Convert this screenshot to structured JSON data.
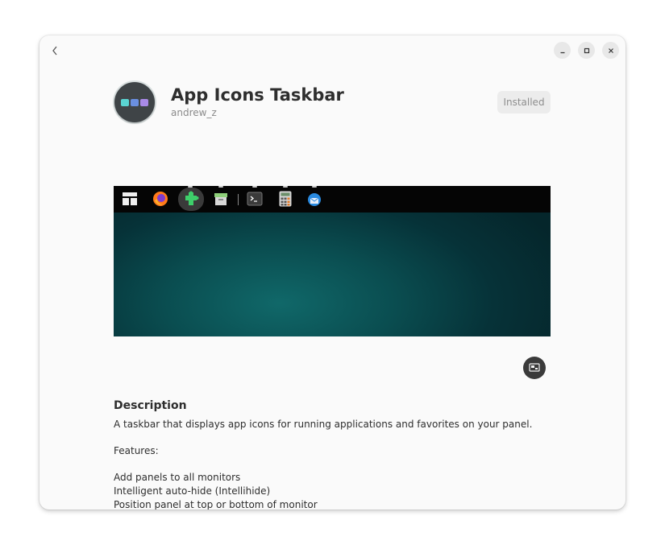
{
  "app": {
    "name": "App Icons Taskbar",
    "author": "andrew_z",
    "install_status": "Installed",
    "icon": "app-icons-taskbar-icon",
    "icon_colors": [
      "#5ad4d2",
      "#6a8fe0",
      "#a98ae8"
    ]
  },
  "window_controls": {
    "back_icon": "chevron-left-icon",
    "minimize_icon": "minimize-icon",
    "maximize_icon": "maximize-icon",
    "close_icon": "close-icon"
  },
  "screenshot": {
    "taskbar_icons": [
      "layout-icon",
      "firefox-icon",
      "extensions-icon",
      "archive-icon",
      "terminal-icon",
      "calculator-icon",
      "thunderbird-icon"
    ],
    "wallpaper_color": "#0a4d50"
  },
  "share_icon": "share-screen-icon",
  "description": {
    "heading": "Description",
    "summary": "A taskbar that displays app icons for running applications and favorites on your panel.",
    "features_label": "Features:",
    "features": [
      "Add panels to all monitors",
      "Intelligent auto-hide (Intellihide)",
      "Position panel at top or bottom of monitor"
    ]
  }
}
